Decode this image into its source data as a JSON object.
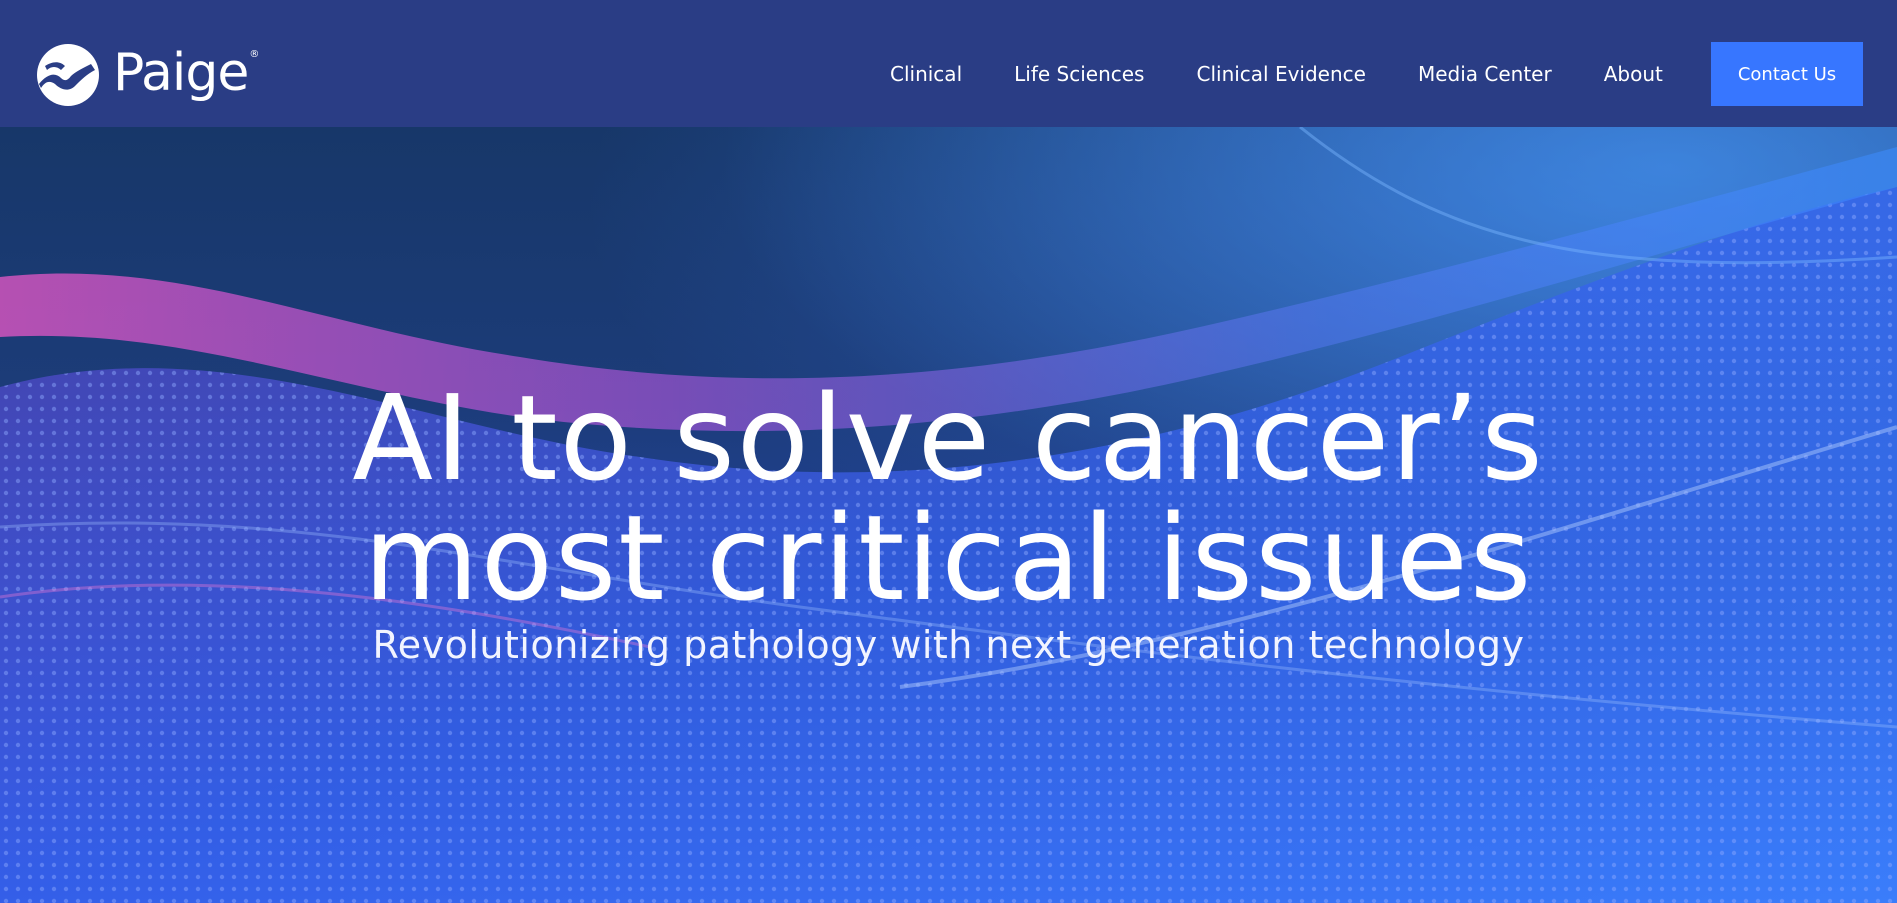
{
  "header": {
    "logo_text": "Paige",
    "logo_reg": "®",
    "nav": [
      {
        "label": "Clinical"
      },
      {
        "label": "Life Sciences"
      },
      {
        "label": "Clinical Evidence"
      },
      {
        "label": "Media Center"
      },
      {
        "label": "About"
      }
    ],
    "contact_label": "Contact Us"
  },
  "hero": {
    "title_line_1": "AI to solve cancer’s",
    "title_line_2": "most critical issues",
    "subtitle": "Revolutionizing pathology with next generation technology"
  },
  "colors": {
    "header_bg": "#2a3d85",
    "accent": "#3776ff",
    "hero_pink": "#e45ad8",
    "hero_blue": "#3b7bff"
  }
}
